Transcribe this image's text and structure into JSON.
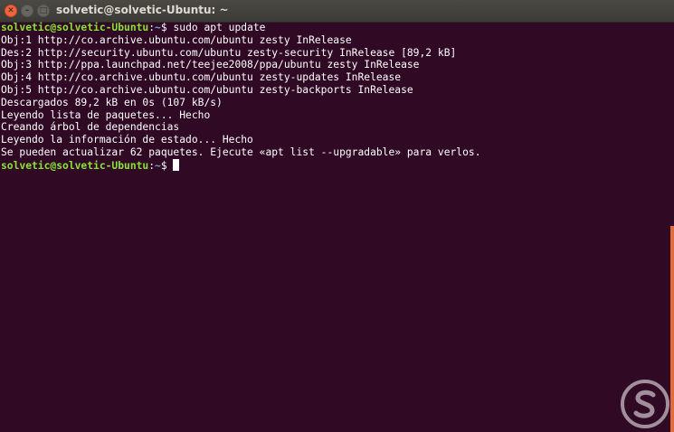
{
  "window": {
    "title": "solvetic@solvetic-Ubuntu: ~"
  },
  "icons": {
    "close": "close-icon",
    "minimize": "minimize-icon",
    "maximize": "maximize-icon",
    "watermark": "solvetic-logo-icon"
  },
  "colors": {
    "background": "#300a24",
    "prompt_user": "#8ae234",
    "prompt_path": "#729fcf",
    "text": "#ffffff",
    "scrollbar": "#e26a3c"
  },
  "terminal": {
    "prompt1": {
      "user": "solvetic@solvetic-Ubuntu",
      "colon": ":",
      "path": "~",
      "symbol": "$ ",
      "command": "sudo apt update"
    },
    "output": [
      "Obj:1 http://co.archive.ubuntu.com/ubuntu zesty InRelease",
      "Des:2 http://security.ubuntu.com/ubuntu zesty-security InRelease [89,2 kB]",
      "Obj:3 http://ppa.launchpad.net/teejee2008/ppa/ubuntu zesty InRelease",
      "Obj:4 http://co.archive.ubuntu.com/ubuntu zesty-updates InRelease",
      "Obj:5 http://co.archive.ubuntu.com/ubuntu zesty-backports InRelease",
      "Descargados 89,2 kB en 0s (107 kB/s)",
      "Leyendo lista de paquetes... Hecho",
      "Creando árbol de dependencias",
      "Leyendo la información de estado... Hecho",
      "Se pueden actualizar 62 paquetes. Ejecute «apt list --upgradable» para verlos."
    ],
    "prompt2": {
      "user": "solvetic@solvetic-Ubuntu",
      "colon": ":",
      "path": "~",
      "symbol": "$ "
    }
  }
}
